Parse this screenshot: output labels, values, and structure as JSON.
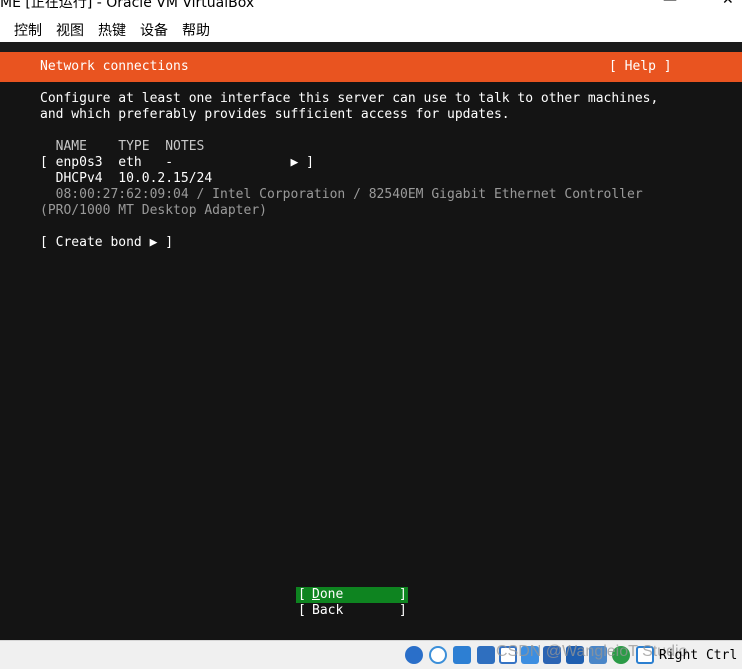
{
  "window": {
    "title": "ME [正在运行] - Oracle VM VirtualBox",
    "minimize_glyph": "—",
    "close_glyph": "✕"
  },
  "menubar": {
    "items": [
      "控制",
      "视图",
      "热键",
      "设备",
      "帮助"
    ]
  },
  "installer": {
    "header_title": "Network connections",
    "help_label": "[ Help ]",
    "intro_line1": "Configure at least one interface this server can use to talk to other machines,",
    "intro_line2": "and which preferably provides sufficient access for updates.",
    "columns_header": "  NAME    TYPE  NOTES",
    "interface_row": "[ enp0s3  eth   -               ▶ ]",
    "dhcp_row": "  DHCPv4  10.0.2.15/24",
    "hw_line1": "  08:00:27:62:09:04 / Intel Corporation / 82540EM Gigabit Ethernet Controller",
    "hw_line2": "(PRO/1000 MT Desktop Adapter)",
    "create_bond": "[ Create bond ▶ ]",
    "done_button": {
      "left_bracket": "[",
      "label": "Done",
      "right_bracket": "]"
    },
    "back_button": {
      "left_bracket": "[",
      "label": "Back",
      "right_bracket": "]"
    },
    "colors": {
      "accent": "#e95420",
      "done_bg": "#0e8420",
      "screen_bg": "#141414"
    }
  },
  "statusbar": {
    "watermark": "CSDN @WangleioT Studio",
    "host_key": "Right Ctrl",
    "icons": [
      "hard-disk-icon",
      "optical-drive-icon",
      "audio-icon",
      "network-icon",
      "usb-icon",
      "shared-folders-icon",
      "display-icon",
      "recording-icon",
      "cpu-icon",
      "features-icon",
      "mouse-integration-icon",
      "keyboard-icon"
    ]
  }
}
